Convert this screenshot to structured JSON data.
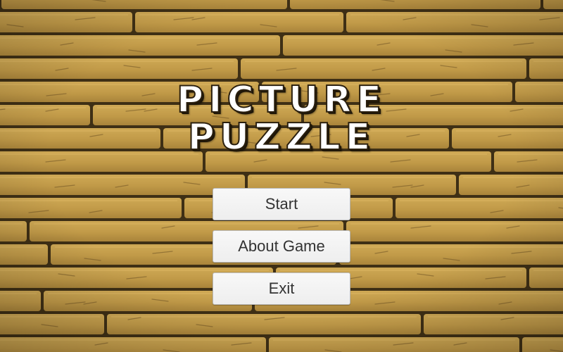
{
  "screen": "main-menu",
  "title": {
    "line1": "PICTURE",
    "line2": "PUZZLE"
  },
  "menu": {
    "start_label": "Start",
    "about_label": "About Game",
    "exit_label": "Exit"
  },
  "background": {
    "texture": "wooden-plank-floor",
    "plank_color": "#c19a48",
    "plank_shadow": "#8a6a2a",
    "seam_color": "#3e2f15"
  },
  "colors": {
    "title_fill": "#ffffff",
    "title_outline": "#2a1f0e",
    "button_bg": "#f2f2f2",
    "button_text": "#333333"
  }
}
